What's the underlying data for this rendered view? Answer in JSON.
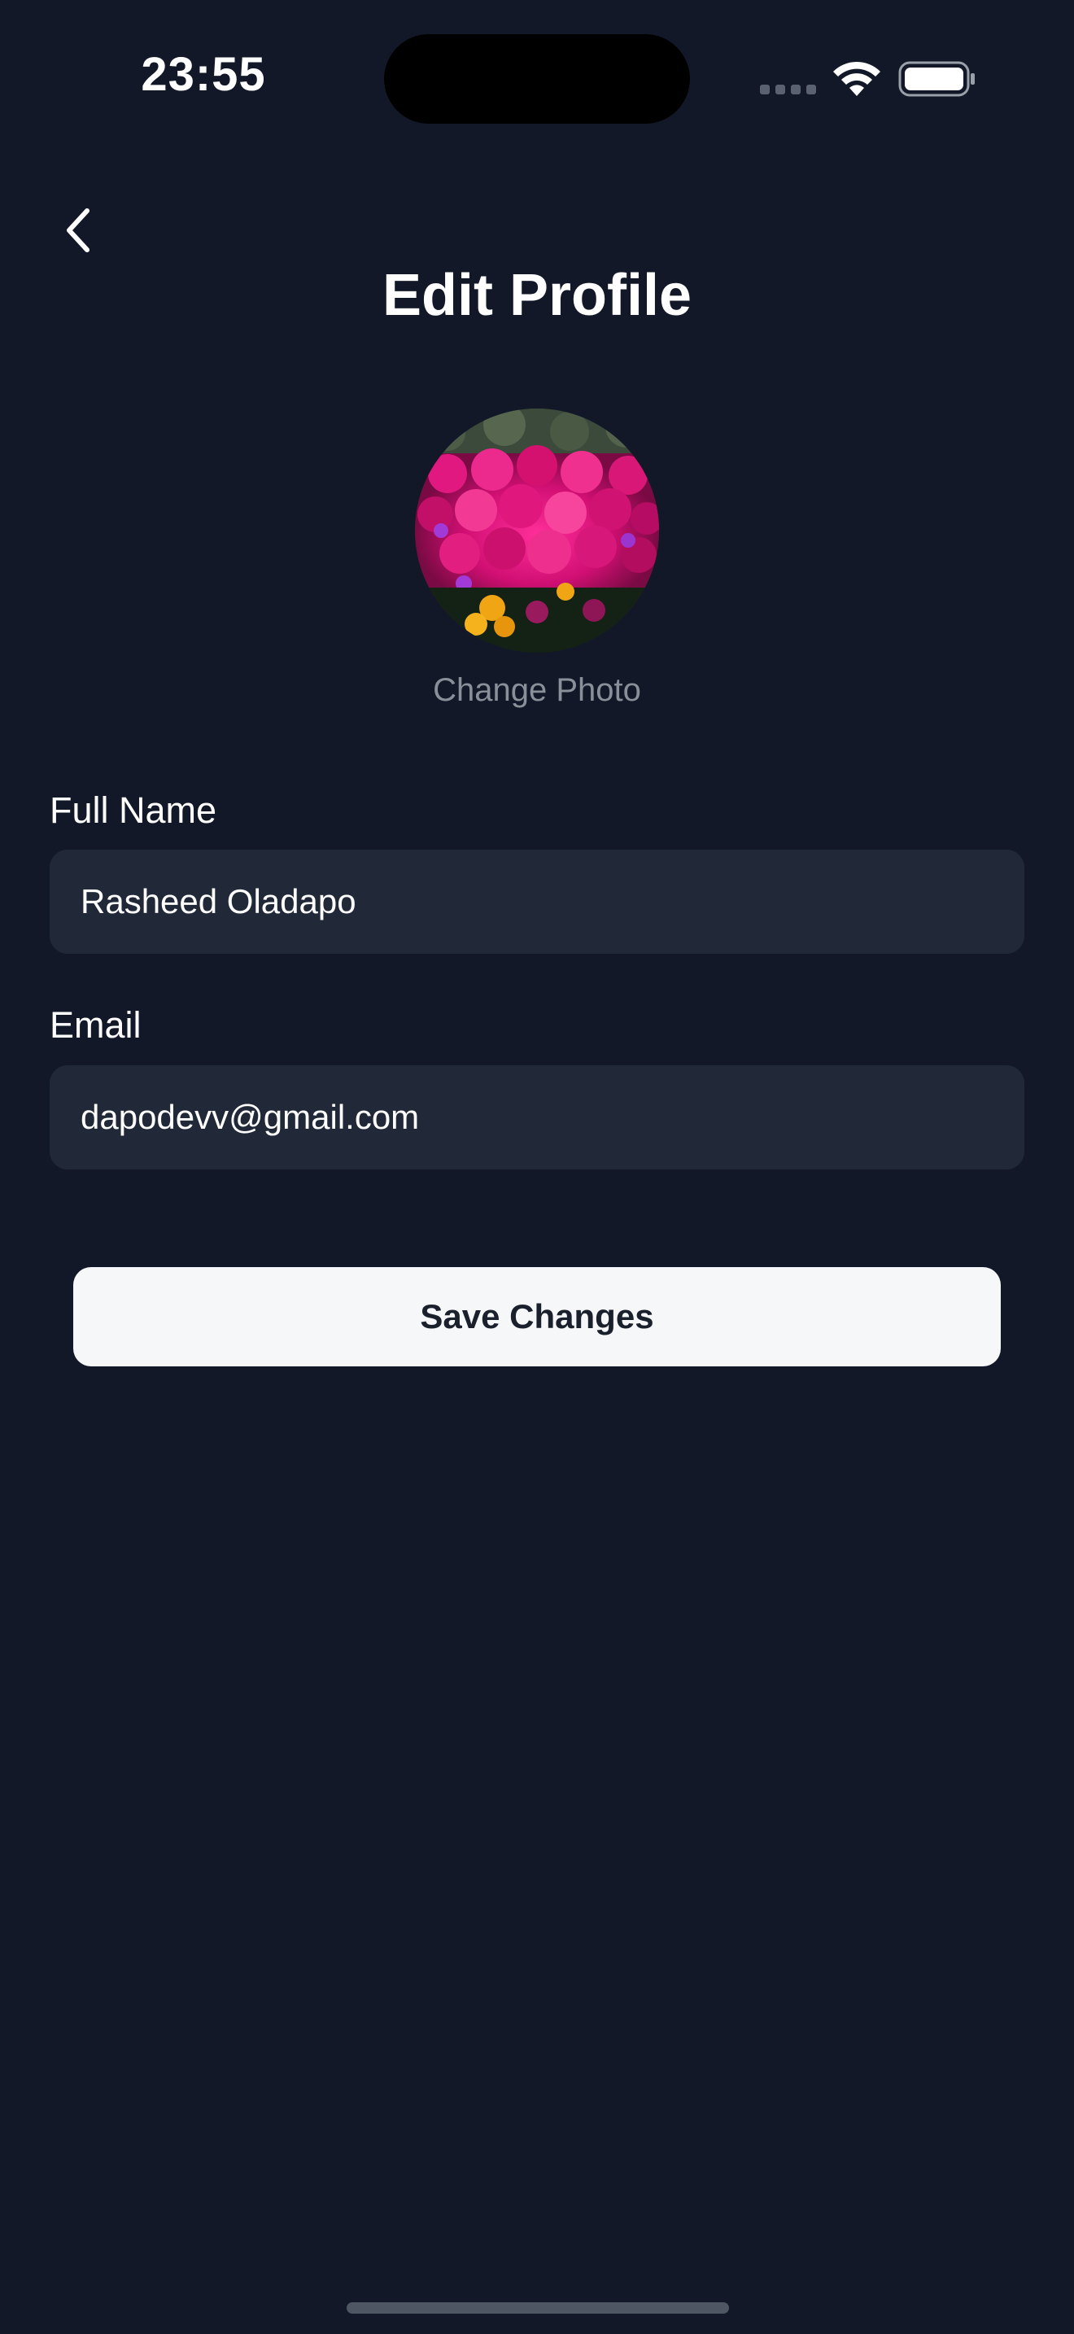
{
  "status_bar": {
    "time": "23:55",
    "icons": [
      "cellular-signal-icon",
      "wifi-icon",
      "battery-icon"
    ]
  },
  "header": {
    "back_icon": "chevron-left-icon",
    "title": "Edit Profile"
  },
  "profile_photo": {
    "change_label": "Change Photo"
  },
  "form": {
    "full_name": {
      "label": "Full Name",
      "value": "Rasheed Oladapo"
    },
    "email": {
      "label": "Email",
      "value": "dapodevv@gmail.com"
    },
    "save_label": "Save Changes"
  },
  "colors": {
    "background": "#121827",
    "input_background": "#212938",
    "button_background": "#f6f7f9",
    "button_text": "#1a202c",
    "muted_text": "#8a8f99"
  }
}
